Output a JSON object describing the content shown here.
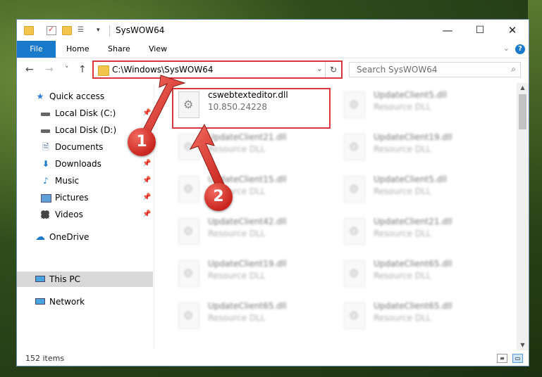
{
  "window": {
    "title": "SysWOW64",
    "controls": {
      "minimize": "—",
      "maximize": "☐",
      "close": "✕"
    }
  },
  "ribbon": {
    "tabs": [
      "File",
      "Home",
      "Share",
      "View"
    ],
    "help": "?"
  },
  "navigation": {
    "back": "←",
    "forward": "→",
    "recent": "˅",
    "up": "↑",
    "address": "C:\\Windows\\SysWOW64",
    "search_placeholder": "Search SysWOW64"
  },
  "sidebar": {
    "items": [
      {
        "label": "Quick access",
        "icon": "star-icon"
      },
      {
        "label": "Local Disk (C:)",
        "icon": "drive-icon",
        "pinned": true
      },
      {
        "label": "Local Disk (D:)",
        "icon": "drive-icon",
        "pinned": false
      },
      {
        "label": "Documents",
        "icon": "documents-icon",
        "pinned": true
      },
      {
        "label": "Downloads",
        "icon": "downloads-icon",
        "pinned": true
      },
      {
        "label": "Music",
        "icon": "music-icon",
        "pinned": true
      },
      {
        "label": "Pictures",
        "icon": "pictures-icon",
        "pinned": true
      },
      {
        "label": "Videos",
        "icon": "videos-icon",
        "pinned": true
      },
      {
        "label": "OneDrive",
        "icon": "cloud-icon"
      },
      {
        "label": "This PC",
        "icon": "computer-icon",
        "selected": true
      },
      {
        "label": "Network",
        "icon": "network-icon"
      }
    ]
  },
  "files": [
    {
      "name": "cswebtexteditor.dll",
      "detail": "10.850.24228",
      "highlighted": true
    },
    {
      "name": "UpdateClient5.dll",
      "detail": "Resource DLL"
    },
    {
      "name": "UpdateClient21.dll",
      "detail": "Resource DLL"
    },
    {
      "name": "UpdateClient19.dll",
      "detail": "Resource DLL"
    },
    {
      "name": "UpdateClient15.dll",
      "detail": "Resource DLL"
    },
    {
      "name": "UpdateClient5.dll",
      "detail": "Resource DLL"
    },
    {
      "name": "UpdateClient42.dll",
      "detail": "Resource DLL"
    },
    {
      "name": "UpdateClient21.dll",
      "detail": "Resource DLL"
    },
    {
      "name": "UpdateClient19.dll",
      "detail": "Resource DLL"
    },
    {
      "name": "UpdateClient65.dll",
      "detail": "Resource DLL"
    },
    {
      "name": "UpdateClient65.dll",
      "detail": "Resource DLL"
    },
    {
      "name": "UpdateClient65.dll",
      "detail": "Resource DLL"
    }
  ],
  "status": {
    "count": "152 items"
  },
  "callouts": [
    "1",
    "2"
  ],
  "colors": {
    "accent": "#1979ca",
    "highlight": "#d9363e",
    "selected": "#d9d9d9"
  }
}
